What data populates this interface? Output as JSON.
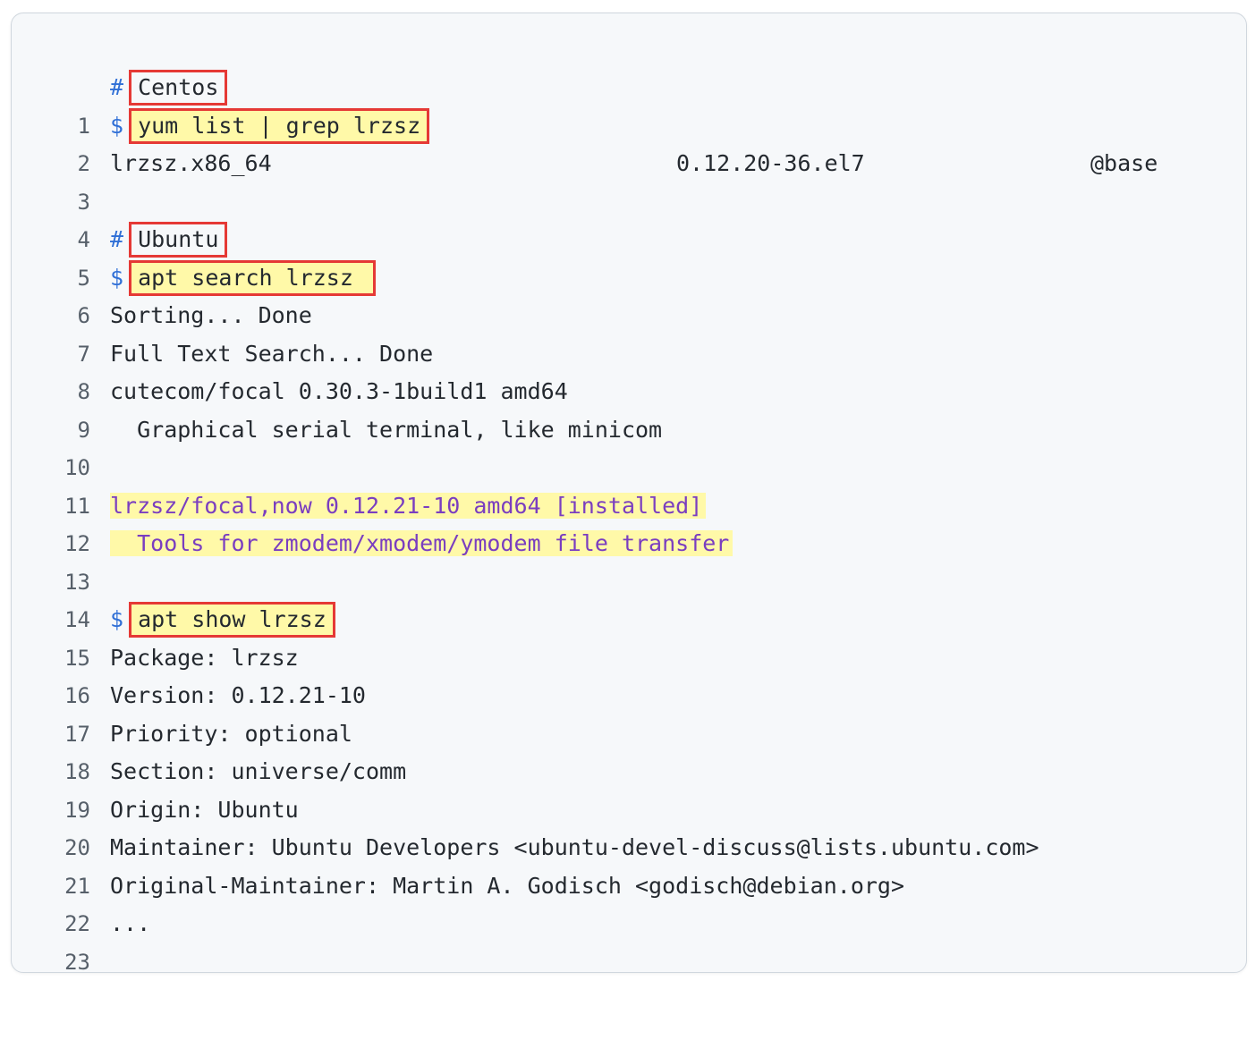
{
  "code": {
    "lines": [
      {
        "n": "1",
        "prefix": "#",
        "text": "Centos"
      },
      {
        "n": "2",
        "prefix": "$",
        "text": "yum list | grep lrzsz"
      },
      {
        "n": "3",
        "name": "lrzsz.x86_64",
        "version": "0.12.20-36.el7",
        "repo": "@base"
      },
      {
        "n": "4",
        "text": ""
      },
      {
        "n": "5",
        "prefix": "#",
        "text": "Ubuntu"
      },
      {
        "n": "6",
        "prefix": "$",
        "text": "apt search lrzsz "
      },
      {
        "n": "7",
        "text": "Sorting... Done"
      },
      {
        "n": "8",
        "text": "Full Text Search... Done"
      },
      {
        "n": "9",
        "text": "cutecom/focal 0.30.3-1build1 amd64"
      },
      {
        "n": "10",
        "text": "  Graphical serial terminal, like minicom"
      },
      {
        "n": "11",
        "text": ""
      },
      {
        "n": "12",
        "text": "lrzsz/focal,now 0.12.21-10 amd64 [installed]"
      },
      {
        "n": "13",
        "text": "  Tools for zmodem/xmodem/ymodem file transfer"
      },
      {
        "n": "14",
        "text": ""
      },
      {
        "n": "15",
        "prefix": "$",
        "text": "apt show lrzsz"
      },
      {
        "n": "16",
        "text": "Package: lrzsz"
      },
      {
        "n": "17",
        "text": "Version: 0.12.21-10"
      },
      {
        "n": "18",
        "text": "Priority: optional"
      },
      {
        "n": "19",
        "text": "Section: universe/comm"
      },
      {
        "n": "20",
        "text": "Origin: Ubuntu"
      },
      {
        "n": "21",
        "text": "Maintainer: Ubuntu Developers <ubuntu-devel-discuss@lists.ubuntu.com>"
      },
      {
        "n": "22",
        "text": "Original-Maintainer: Martin A. Godisch <godisch@debian.org>"
      },
      {
        "n": "23",
        "text": "..."
      }
    ]
  },
  "colors": {
    "highlight": "#fff9a8",
    "box_border": "#e53935",
    "prefix": "#2f6fd6",
    "highlight_text": "#7a3ec0"
  }
}
